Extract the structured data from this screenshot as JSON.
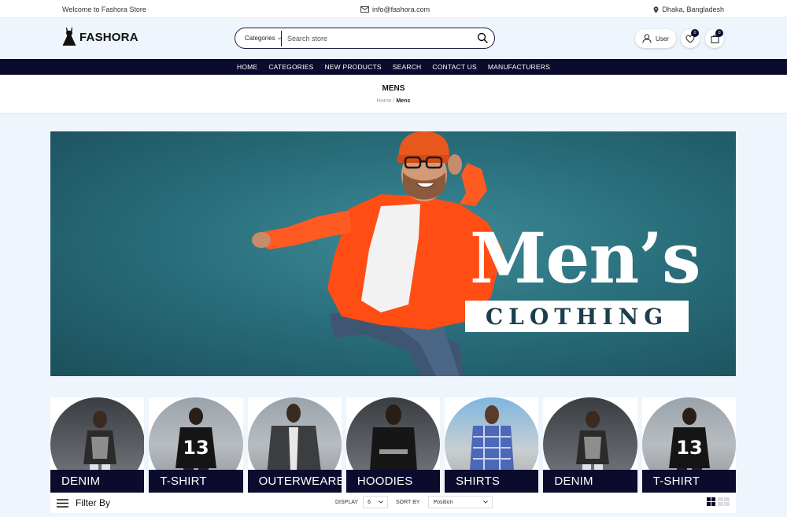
{
  "topbar": {
    "welcome": "Welcome to Fashora Store",
    "email": "info@fashora.com",
    "location": "Dhaka, Bangladesh"
  },
  "header": {
    "logo_text": "FASHORA",
    "search": {
      "category_label": "Categories",
      "placeholder": "Search store"
    },
    "user_label": "User",
    "wishlist_count": "0",
    "cart_count": "0"
  },
  "nav": {
    "items": [
      "HOME",
      "CATEGORIES",
      "NEW PRODUCTS",
      "SEARCH",
      "CONTACT US",
      "MANUFACTURERS"
    ]
  },
  "page": {
    "title": "MENS",
    "breadcrumb_home": "Home",
    "breadcrumb_sep": "/",
    "breadcrumb_current": "Mens"
  },
  "banner": {
    "headline": "Men’s",
    "subline": "CLOTHING"
  },
  "categories": [
    {
      "label": "DENIM"
    },
    {
      "label": "T-SHIRT"
    },
    {
      "label": "OUTERWEARE"
    },
    {
      "label": "HOODIES"
    },
    {
      "label": "SHIRTS"
    },
    {
      "label": "DENIM"
    },
    {
      "label": "T-SHIRT"
    }
  ],
  "filters": {
    "filter_by": "Filter By",
    "display_label": "DISPLAY",
    "display_value": "6",
    "sort_label": "SORT BY",
    "sort_value": "Position"
  },
  "colors": {
    "brand_navy": "#0b0b2e",
    "page_bg": "#eef5fc",
    "accent_orange": "#ff4d14"
  }
}
